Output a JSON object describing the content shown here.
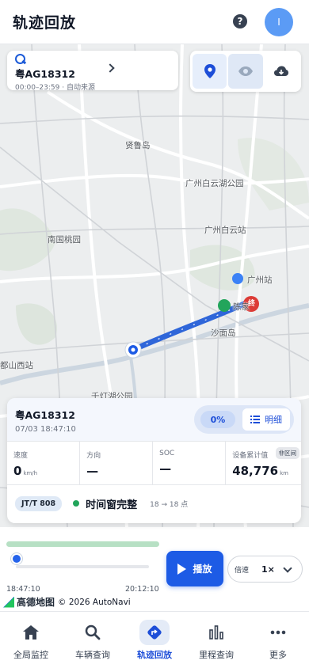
{
  "header": {
    "title": "轨迹回放",
    "help_icon": "question-circle-icon",
    "avatar_initial": "I"
  },
  "vehicle_chip": {
    "plate": "粤AG18312",
    "time_range": "00:00–23:59 · 自动来源"
  },
  "map": {
    "labels": [
      "贤鲁岛",
      "广州白云湖公园",
      "南国桃园",
      "广州白云站",
      "广州站",
      "陈家",
      "沙面岛",
      "都山西站",
      "千灯湖公园"
    ],
    "start_marker": "起",
    "end_marker": "终",
    "route_color": "#2f66d9"
  },
  "map_tools": [
    {
      "name": "location-pin-icon",
      "active": true
    },
    {
      "name": "eye-icon",
      "active": false
    },
    {
      "name": "cloud-download-icon",
      "active": false
    }
  ],
  "info_card": {
    "plate": "粤AG18312",
    "time": "07/03 18:47:10",
    "progress_pct": "0%",
    "detail_label": "明细",
    "stats": [
      {
        "label": "速度",
        "value": "0",
        "unit": "km/h"
      },
      {
        "label": "方向",
        "value": "—",
        "unit": ""
      },
      {
        "label": "SOC",
        "value": "—",
        "unit": ""
      },
      {
        "label": "设备累计值",
        "value": "48,776",
        "unit": "km",
        "tag": "非区间"
      }
    ],
    "protocol": "JT/T 808",
    "window_status": "时间窗完整",
    "window_range": "18 → 18 点"
  },
  "playback": {
    "loaded_fraction": 0.5,
    "position_fraction": 0.0,
    "start_time": "18:47:10",
    "end_time": "20:12:10",
    "play_label": "播放",
    "speed_label": "倍速",
    "speed_value": "1×",
    "brand": "高德地图",
    "copyright": "© 2026 AutoNavi"
  },
  "nav": [
    {
      "label": "全局监控",
      "icon": "home-icon",
      "active": false
    },
    {
      "label": "车辆查询",
      "icon": "search-icon",
      "active": false
    },
    {
      "label": "轨迹回放",
      "icon": "route-icon",
      "active": true
    },
    {
      "label": "里程查询",
      "icon": "bar-chart-icon",
      "active": false
    },
    {
      "label": "更多",
      "icon": "more-dots-icon",
      "active": false
    }
  ]
}
